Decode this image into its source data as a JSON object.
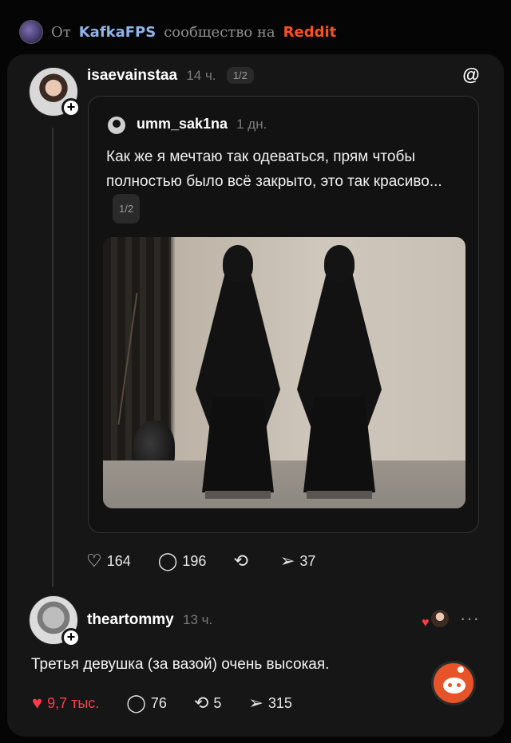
{
  "topbar": {
    "prefix": "От",
    "community": "KafkaFPS",
    "middle": "сообщество на",
    "platform": "Reddit"
  },
  "post": {
    "username": "isaevainstaa",
    "time": "14 ч.",
    "page_indicator": "1/2",
    "quote": {
      "username": "umm_sak1na",
      "time": "1 дн.",
      "text": "Как же я мечтаю так одеваться, прям чтобы полностью было всё закрыто, это так красиво...",
      "page_indicator": "1/2"
    },
    "actions": {
      "likes": "164",
      "comments": "196",
      "shares": "37"
    }
  },
  "reply": {
    "username": "theartommy",
    "time": "13 ч.",
    "text": "Третья девушка (за вазой) очень высокая.",
    "actions": {
      "likes": "9,7 тыс.",
      "comments": "76",
      "reposts": "5",
      "shares": "315"
    }
  },
  "icons": {
    "heart": "♡",
    "heart_filled": "♥",
    "comment": "◯",
    "repost": "⟲",
    "share": "➢",
    "threads": "@",
    "more": "···"
  },
  "colors": {
    "accent_reddit": "#ff4f1f",
    "like_red": "#ff3b4a",
    "community_blue": "#8fb4e8"
  }
}
